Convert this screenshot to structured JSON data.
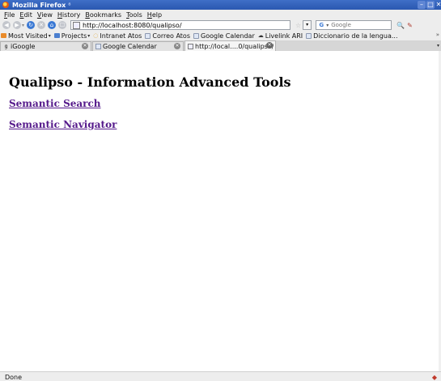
{
  "window": {
    "title": "Mozilla Firefox",
    "title_suffix": "⁸",
    "min": "–",
    "max": "□",
    "close": "✕"
  },
  "menu": {
    "items": [
      "File",
      "Edit",
      "View",
      "History",
      "Bookmarks",
      "Tools",
      "Help"
    ]
  },
  "toolbar": {
    "back": "◀",
    "forward": "▶",
    "reload": "↻",
    "stop": "✕",
    "home": "⌂",
    "bookmark_glyph": "☐",
    "url": "http://localhost:8080/qualipso/",
    "star": "☆",
    "dropdown": "▾",
    "search_engine": "G",
    "search_placeholder": "Google",
    "search_go": "🔍"
  },
  "bookmarks": {
    "items": [
      {
        "label": "Most Visited",
        "dropdown": true,
        "icon": "folder-orange"
      },
      {
        "label": "Projects",
        "dropdown": true,
        "icon": "folder-blue"
      },
      {
        "label": "Intranet Atos",
        "dropdown": false,
        "icon": "atos"
      },
      {
        "label": "Correo Atos",
        "dropdown": false,
        "icon": "page"
      },
      {
        "label": "Google Calendar",
        "dropdown": false,
        "icon": "page"
      },
      {
        "label": "Livelink ARI",
        "dropdown": false,
        "icon": "swoosh"
      },
      {
        "label": "Diccionario de la lengua...",
        "dropdown": false,
        "icon": "page"
      }
    ],
    "overflow": "»"
  },
  "tabs": [
    {
      "label": "iGoogle",
      "icon": "g",
      "active": false
    },
    {
      "label": "Google Calendar",
      "icon": "cal",
      "active": false
    },
    {
      "label": "http://local....0/qualipso/",
      "icon": "page",
      "active": true
    }
  ],
  "page": {
    "heading": "Qualipso - Information Advanced Tools",
    "links": [
      "Semantic Search",
      "Semantic Navigator"
    ]
  },
  "status": {
    "text": "Done",
    "icon": "◆"
  },
  "colors": {
    "titlebar": "#2a58b0",
    "visited_link": "#551a8b"
  }
}
